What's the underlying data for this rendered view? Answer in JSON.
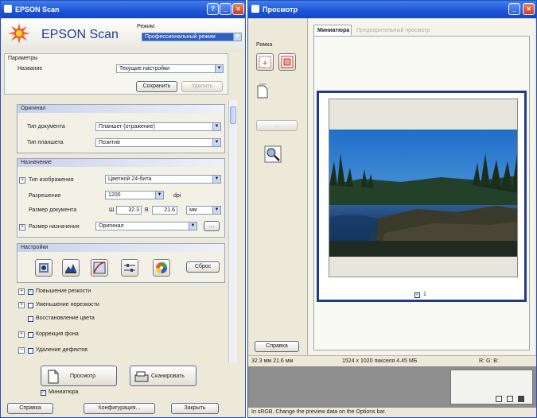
{
  "main_window": {
    "title": "EPSON Scan",
    "brand": "EPSON Scan",
    "mode_label": "Режим:",
    "mode_value": "Профессиональный режим",
    "params": {
      "label": "Параметры",
      "name_label": "Название",
      "name_value": "Текущие настройки",
      "save_button": "Сохранить",
      "delete_button": "Удалить"
    },
    "original": {
      "header": "Оригинал",
      "doc_type_label": "Тип документа",
      "doc_type_value": "Планшет (отражение)",
      "autoexp_label": "Тип планшета",
      "autoexp_value": "Позитив"
    },
    "target": {
      "header": "Назначение",
      "image_type_label": "Тип изображения",
      "image_type_value": "Цветной 24-бита",
      "resolution_label": "Разрешение",
      "resolution_value": "1200",
      "resolution_unit": "dpi",
      "doc_size_label": "Размер документа",
      "width_prefix": "Ш",
      "width_value": "32.3",
      "height_prefix": "В",
      "height_value": "21.6",
      "size_unit": "мм",
      "target_size_label": "Размер назначения",
      "target_size_value": "Оригинал"
    },
    "adjust": {
      "header": "Настройки",
      "reset_button": "Сброс"
    },
    "options": [
      {
        "label": "Повышение резкости",
        "checked": true
      },
      {
        "label": "Уменьшение нерезкости",
        "checked": false
      },
      {
        "label": "Восстановление цвета",
        "checked": false
      },
      {
        "label": "Коррекция фона",
        "checked": false
      },
      {
        "label": "Удаление дефектов",
        "checked": false
      }
    ],
    "preview_button": "Просмотр",
    "scan_button": "Сканировать",
    "thumbnail_check": "Миниатюра",
    "help_button": "Справка",
    "config_button": "Конфигурация...",
    "close_button": "Закрыть"
  },
  "preview_window": {
    "title": "Просмотр",
    "frame_label": "Рамка",
    "tab_thumbnail": "Миниатюра",
    "tab_normal": "Предварительный просмотр",
    "frame_number": "1",
    "help_button": "Справка",
    "status_size": "32.3 мм  21.6 мм",
    "status_pixels": "1524 x 1020 пикселя 4.45 МБ",
    "status_rgb": "R: G: B:",
    "hint": "In sRGB. Change the preview data on the Options bar."
  },
  "colors": {
    "title_blue": "#1c54d6",
    "accent_red": "#c6401f",
    "panel": "#ece9d8"
  }
}
